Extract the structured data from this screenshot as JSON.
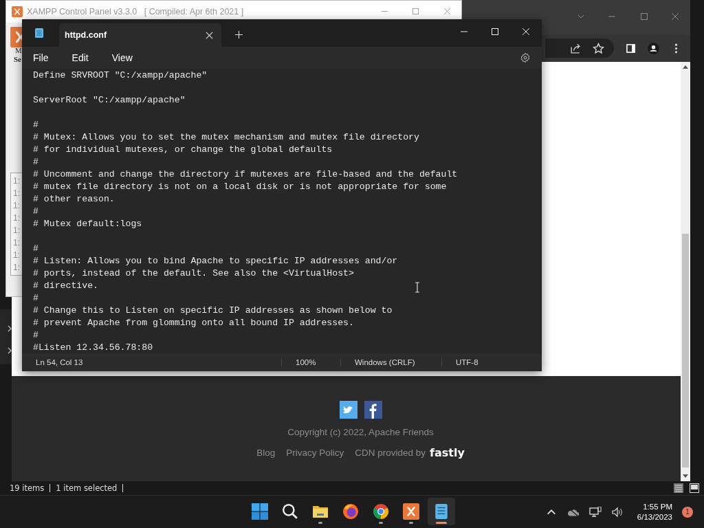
{
  "xampp_window": {
    "title": "XAMPP Control Panel v3.3.0   [ Compiled: Apr 6th 2021 ]",
    "labels": [
      "M",
      "Se"
    ],
    "log_lines": [
      "1:",
      "1:",
      "1:",
      "1:",
      "1:",
      "1:",
      "1:",
      "1:"
    ]
  },
  "notepad": {
    "tabs": [
      {
        "label": "httpd.conf",
        "selected": true
      }
    ],
    "menu": [
      "File",
      "Edit",
      "View"
    ],
    "paragraphs": [
      [
        "Define SRVROOT \"C:/xampp/apache\""
      ],
      [
        "ServerRoot \"C:/xampp/apache\""
      ],
      [
        "#",
        "# Mutex: Allows you to set the mutex mechanism and mutex file directory",
        "# for individual mutexes, or change the global defaults",
        "#",
        "# Uncomment and change the directory if mutexes are file-based and the default",
        "# mutex file directory is not on a local disk or is not appropriate for some",
        "# other reason.",
        "#",
        "# Mutex default:logs"
      ],
      [
        "#",
        "# Listen: Allows you to bind Apache to specific IP addresses and/or",
        "# ports, instead of the default. See also the <VirtualHost>",
        "# directive.",
        "#",
        "# Change this to Listen on specific IP addresses as shown below to",
        "# prevent Apache from glomming onto all bound IP addresses.",
        "#",
        "#Listen 12.34.56.78:80"
      ]
    ],
    "status_bar": {
      "position": "Ln 54, Col 13",
      "zoom": "100%",
      "line_endings": "Windows (CRLF)",
      "encoding": "UTF-8"
    }
  },
  "browser": {
    "footer": {
      "copyright": "Copyright (c) 2022, Apache Friends",
      "links": [
        "Blog",
        "Privacy Policy"
      ],
      "cdn_text": "CDN provided by",
      "cdn_logo": "fastly"
    }
  },
  "explorer": {
    "status": [
      "19 items",
      "1 item selected"
    ]
  },
  "taskbar": {
    "apps": [
      {
        "kind": "start",
        "running": false,
        "selected": false
      },
      {
        "kind": "search",
        "running": false,
        "selected": false
      },
      {
        "kind": "folder",
        "running": true,
        "selected": false
      },
      {
        "kind": "firefox",
        "running": false,
        "selected": false
      },
      {
        "kind": "chrome",
        "running": true,
        "selected": false
      },
      {
        "kind": "xampp",
        "running": true,
        "selected": false
      },
      {
        "kind": "notepad",
        "running": true,
        "selected": true
      }
    ],
    "time": "1:55 PM",
    "date": "6/13/2023",
    "notifications": "1"
  }
}
